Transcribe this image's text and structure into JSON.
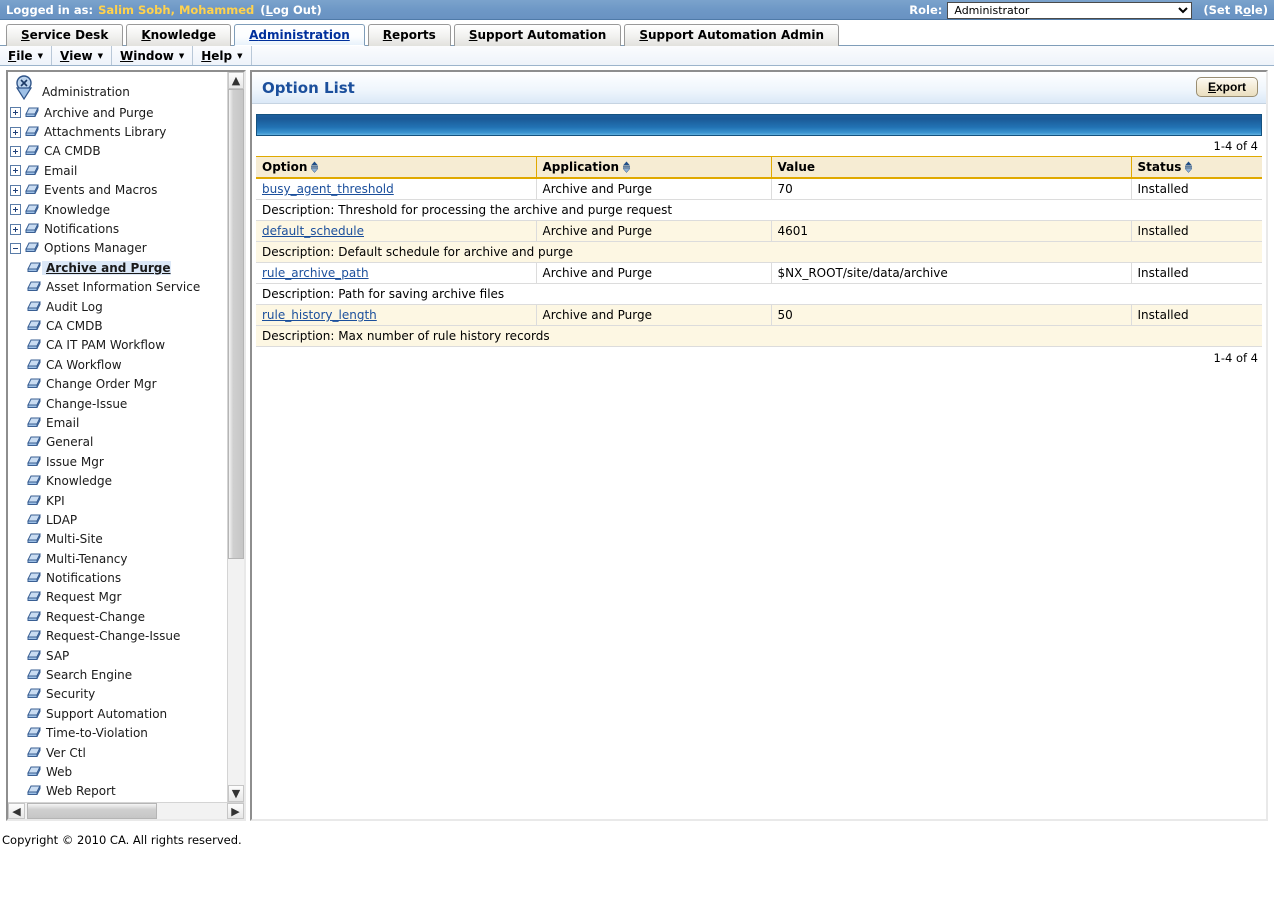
{
  "topbar": {
    "logged_in_label": "Logged in as:",
    "user_name": "Salim Sobh, Mohammed",
    "logout_open_paren": "(",
    "logout_label_first": "L",
    "logout_label_rest": "og Out",
    "logout_close_paren": ")",
    "role_label": "Role:",
    "role_value": "Administrator",
    "role_options": [
      "Administrator"
    ],
    "set_role_open_paren": "(",
    "set_role_label_pre": "Set R",
    "set_role_label_accel": "o",
    "set_role_label_post": "le",
    "set_role_close_paren": ")"
  },
  "tabs": [
    {
      "accel": "S",
      "rest": "ervice Desk",
      "active": false
    },
    {
      "accel": "K",
      "rest": "nowledge",
      "active": false
    },
    {
      "accel": "A",
      "rest": "dministration",
      "active": true
    },
    {
      "accel": "R",
      "rest": "eports",
      "active": false
    },
    {
      "accel": "S",
      "rest": "upport Automation",
      "active": false
    },
    {
      "accel": "S",
      "rest": "upport Automation Admin",
      "active": false
    }
  ],
  "menu": [
    {
      "accel": "F",
      "rest": "ile"
    },
    {
      "accel": "V",
      "rest": "iew"
    },
    {
      "accel": "W",
      "rest": "indow"
    },
    {
      "accel": "H",
      "rest": "elp"
    }
  ],
  "tree": {
    "root_label": "Administration",
    "top_nodes": [
      "Archive and Purge",
      "Attachments Library",
      "CA CMDB",
      "Email",
      "Events and Macros",
      "Knowledge",
      "Notifications"
    ],
    "expanded_node": "Options Manager",
    "children": [
      "Archive and Purge",
      "Asset Information Service",
      "Audit Log",
      "CA CMDB",
      "CA IT PAM Workflow",
      "CA Workflow",
      "Change Order Mgr",
      "Change-Issue",
      "Email",
      "General",
      "Issue Mgr",
      "Knowledge",
      "KPI",
      "LDAP",
      "Multi-Site",
      "Multi-Tenancy",
      "Notifications",
      "Request Mgr",
      "Request-Change",
      "Request-Change-Issue",
      "SAP",
      "Search Engine",
      "Security",
      "Support Automation",
      "Time-to-Violation",
      "Ver Ctl",
      "Web",
      "Web Report"
    ],
    "selected_child": "Archive and Purge"
  },
  "content": {
    "title": "Option List",
    "export_accel": "E",
    "export_rest": "xport",
    "count_top": "1-4 of 4",
    "count_bottom": "1-4 of 4",
    "columns": [
      "Option",
      "Application",
      "Value",
      "Status"
    ],
    "description_prefix": "Description:",
    "rows": [
      {
        "option": "busy_agent_threshold",
        "application": "Archive and Purge",
        "value": "70",
        "status": "Installed",
        "description": "Description: Threshold for processing the archive and purge request"
      },
      {
        "option": "default_schedule",
        "application": "Archive and Purge",
        "value": "4601",
        "status": "Installed",
        "description": "Description: Default schedule for archive and purge"
      },
      {
        "option": "rule_archive_path",
        "application": "Archive and Purge",
        "value": "$NX_ROOT/site/data/archive",
        "status": "Installed",
        "description": "Description: Path for saving archive files"
      },
      {
        "option": "rule_history_length",
        "application": "Archive and Purge",
        "value": "50",
        "status": "Installed",
        "description": "Description: Max number of rule history records"
      }
    ]
  },
  "footer": {
    "copyright": "Copyright © 2010 CA. All rights reserved."
  },
  "colors": {
    "topbar_blue": "#6e98c6",
    "user_gold": "#ffd24d",
    "title_blue": "#1b4f9c",
    "header_tan": "#f6ecd3",
    "header_rule": "#e0a900",
    "row_cream": "#fdf7e3",
    "link_blue": "#1b4f9c"
  }
}
